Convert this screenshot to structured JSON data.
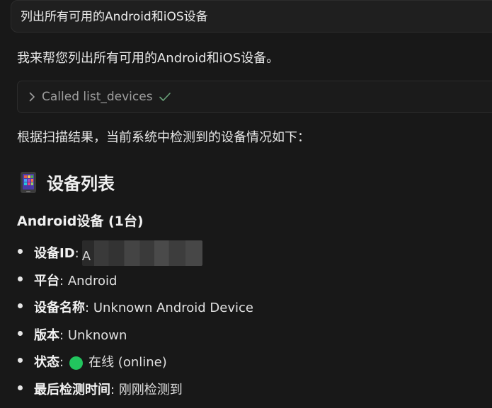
{
  "user_message": "列出所有可用的Android和iOS设备",
  "assistant": {
    "intro": "我来帮您列出所有可用的Android和iOS设备。",
    "tool_call": {
      "label": "Called list_devices",
      "status_glyph": "✓"
    },
    "summary": "根据扫描结果，当前系统中检测到的设备情况如下：",
    "section_icon": "mobile-phone-icon",
    "section_title": "设备列表",
    "android": {
      "title": "Android设备 (1台)",
      "fields": [
        {
          "key": "设备ID",
          "sep": ":",
          "value": "A"
        },
        {
          "key": "平台",
          "sep": ":",
          "value": "Android"
        },
        {
          "key": "设备名称",
          "sep": ":",
          "value": "Unknown Android Device"
        },
        {
          "key": "版本",
          "sep": ":",
          "value": "Unknown"
        },
        {
          "key": "状态",
          "sep": ":",
          "value": "在线 (online)",
          "status_color": "#22c55e"
        },
        {
          "key": "最后检测时间",
          "sep": ":",
          "value": "刚刚检测到"
        }
      ]
    }
  },
  "colors": {
    "background": "#181818",
    "text": "#e6e6e6",
    "muted": "#9e9e9e",
    "check": "#6aa37a",
    "online": "#22c55e"
  }
}
